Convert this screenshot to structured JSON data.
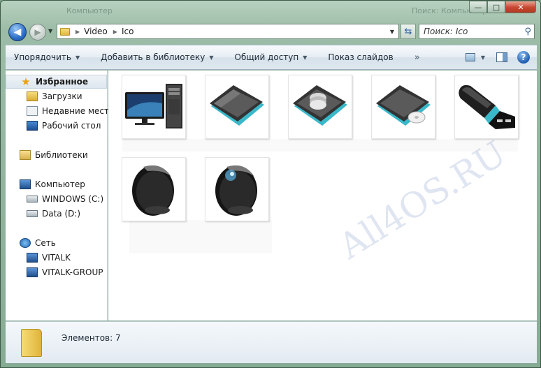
{
  "window": {
    "title_ghost_left": "Компьютер",
    "title_ghost_right": "Поиск: Компьютер"
  },
  "nav": {
    "breadcrumbs": [
      "Video",
      "Ico"
    ],
    "search_placeholder": "Поиск: Ico"
  },
  "toolbar": {
    "items": [
      "Упорядочить",
      "Добавить в библиотеку",
      "Общий доступ",
      "Показ слайдов"
    ],
    "more": "»"
  },
  "sidebar": {
    "favorites": "Избранное",
    "fav_items": [
      "Загрузки",
      "Недавние места",
      "Рабочий стол"
    ],
    "libraries": "Библиотеки",
    "computer": "Компьютер",
    "drives": [
      "WINDOWS (C:)",
      "Data (D:)"
    ],
    "network": "Сеть",
    "net_items": [
      "VITALK",
      "VITALK-GROUP"
    ]
  },
  "content": {
    "watermark": "All4OS.RU",
    "items": [
      {
        "icon": "computer-monitor-tower-icon"
      },
      {
        "icon": "hard-drive-dark-icon"
      },
      {
        "icon": "hard-drive-disc-icon"
      },
      {
        "icon": "hard-drive-cd-icon"
      },
      {
        "icon": "usb-flash-drive-icon"
      },
      {
        "icon": "black-egg-icon"
      },
      {
        "icon": "black-egg-shine-icon"
      }
    ]
  },
  "details": {
    "count": "Элементов: 7"
  },
  "colors": {
    "usb_accent": "#39b8c9",
    "favorites_star": "#e9a013"
  }
}
